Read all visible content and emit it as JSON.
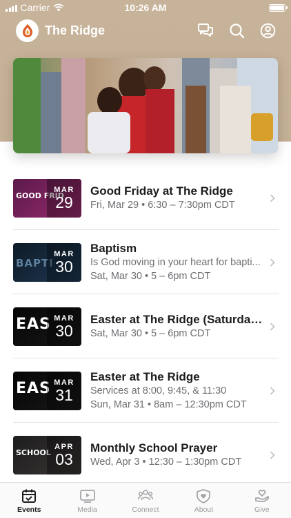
{
  "status_bar": {
    "carrier": "Carrier",
    "time": "10:26 AM"
  },
  "header": {
    "app_title": "The Ridge",
    "icons": [
      "chat-icon",
      "search-icon",
      "profile-icon"
    ]
  },
  "events": [
    {
      "title": "Good Friday at The Ridge",
      "lines": [
        "Fri, Mar 29 • 6:30 – 7:30pm CDT"
      ],
      "month": "MAR",
      "day": "29",
      "thumb_text": "GOOD FRID",
      "thumb_colors": [
        "#5a1a4a",
        "#9b2b6e"
      ]
    },
    {
      "title": "Baptism",
      "lines": [
        "Is God moving in your heart for bapti...",
        "Sat, Mar 30 • 5 – 6pm CDT"
      ],
      "month": "MAR",
      "day": "30",
      "thumb_text": "BAPTI",
      "thumb_colors": [
        "#0e1a26",
        "#1f3a55"
      ]
    },
    {
      "title": "Easter at The Ridge (Saturday...",
      "lines": [
        "Sat, Mar 30 • 5 – 6pm CDT"
      ],
      "month": "MAR",
      "day": "30",
      "thumb_text": "EAS",
      "thumb_colors": [
        "#050505",
        "#1a1a1a"
      ]
    },
    {
      "title": "Easter at The Ridge",
      "lines": [
        "Services at 8:00, 9:45, & 11:30",
        "Sun, Mar 31 • 8am – 12:30pm CDT"
      ],
      "month": "MAR",
      "day": "31",
      "thumb_text": "EAS",
      "thumb_colors": [
        "#050505",
        "#1a1a1a"
      ]
    },
    {
      "title": "Monthly School Prayer",
      "lines": [
        "Wed, Apr 3 • 12:30 – 1:30pm CDT"
      ],
      "month": "APR",
      "day": "03",
      "thumb_text": "SCHOOL",
      "thumb_colors": [
        "#1d1d1d",
        "#3b3535"
      ]
    }
  ],
  "tabs": [
    {
      "label": "Events",
      "icon": "calendar-icon",
      "active": true
    },
    {
      "label": "Media",
      "icon": "play-icon",
      "active": false
    },
    {
      "label": "Connect",
      "icon": "group-icon",
      "active": false
    },
    {
      "label": "About",
      "icon": "shield-heart-icon",
      "active": false
    },
    {
      "label": "Give",
      "icon": "hand-heart-icon",
      "active": false
    }
  ],
  "colors": {
    "header_bg": "#c7b39a",
    "accent_logo": "#e0602a"
  }
}
